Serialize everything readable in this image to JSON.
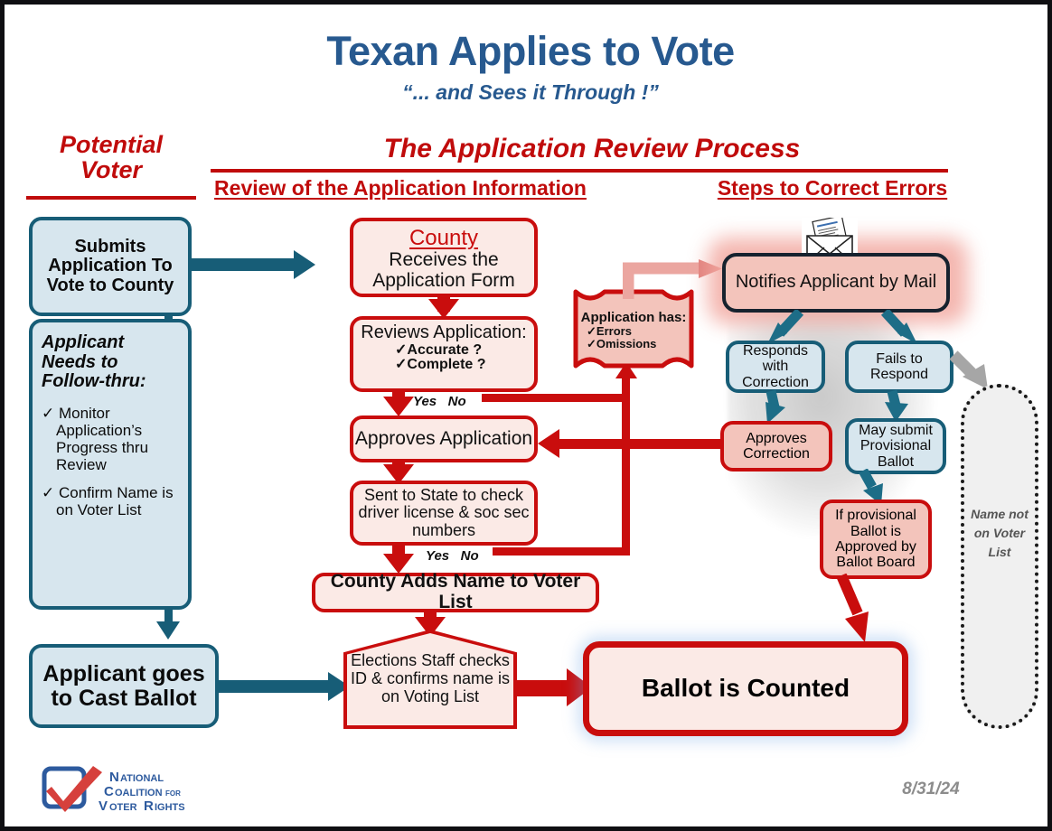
{
  "title": "Texan Applies to Vote",
  "subtitle": "“... and Sees it Through !”",
  "headers": {
    "potential_voter": "Potential\nVoter",
    "process": "The Application Review Process",
    "review": "Review of the Application Information",
    "steps": "Steps to Correct Errors"
  },
  "left_column": {
    "submits": "Submits Application To Vote to County",
    "followthru_title": "Applicant Needs to Follow-thru:",
    "followthru_items": [
      "Monitor Application’s Progress thru Review",
      "Confirm Name is on Voter List"
    ],
    "cast_ballot": "Applicant goes to Cast Ballot"
  },
  "center_column": {
    "county_label": "County",
    "county_body": "Receives the Application Form",
    "reviews_title": "Reviews Application:",
    "reviews_items": [
      "Accurate ?",
      "Complete ?"
    ],
    "decision1_yes": "Yes",
    "decision1_no": "No",
    "approves_application": "Approves Application",
    "sent_to_state": "Sent to State to check driver license & soc sec numbers",
    "decision2_yes": "Yes",
    "decision2_no": "No",
    "county_adds": "County Adds Name to Voter List",
    "elections_staff": "Elections Staff checks ID & confirms name is on Voting List",
    "ballot_counted": "Ballot is Counted"
  },
  "error_node": {
    "title": "Application has:",
    "items": [
      "Errors",
      "Omissions"
    ]
  },
  "right_column": {
    "notifies": "Notifies Applicant by Mail",
    "responds": "Responds with Correction",
    "fails": "Fails to Respond",
    "approves_correction": "Approves Correction",
    "may_submit": "May submit Provisional Ballot",
    "if_provisional": "If provisional Ballot  is Approved by Ballot Board",
    "name_not_on_list": "Name not on Voter List"
  },
  "footer": {
    "logo_line1": "National",
    "logo_line2": "Coalition",
    "logo_line2b": "for",
    "logo_line3": "Voter Rights",
    "date": "8/31/24"
  },
  "colors": {
    "title_blue": "#27598f",
    "red": "#c90d0d",
    "teal": "#175d77",
    "teal_fill": "#d7e6ee",
    "red_fill": "#fbeae6",
    "red_fill_deep": "#f3c4bb"
  },
  "icons": {
    "envelope": "envelope-icon",
    "check": "✓",
    "logo": "checkmark-logo"
  }
}
